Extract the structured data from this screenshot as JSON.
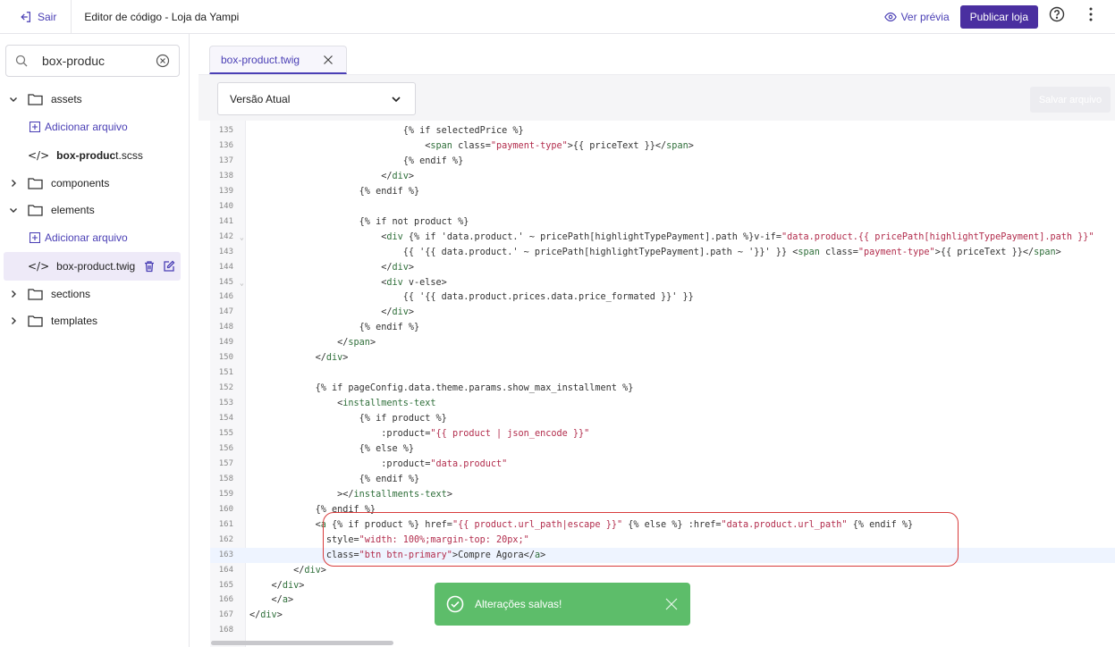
{
  "header": {
    "back_label": "Sair",
    "title": "Editor de código - Loja da Yampi",
    "preview_label": "Ver prévia",
    "publish_label": "Publicar loja"
  },
  "sidebar": {
    "search_value": "box-produc",
    "tree": {
      "assets": "assets",
      "add_file_1": "Adicionar arquivo",
      "scss_bold": "box-produc",
      "scss_rest": "t.scss",
      "components": "components",
      "elements": "elements",
      "add_file_2": "Adicionar arquivo",
      "twig_file": "box-product.twig",
      "sections": "sections",
      "templates": "templates"
    }
  },
  "editor": {
    "tab_label": "box-product.twig",
    "version_label": "Versão Atual",
    "save_label": "Salvar arquivo",
    "lines": [
      {
        "n": "135",
        "t": "                            {% if selectedPrice %}"
      },
      {
        "n": "136",
        "t": "                                <span class=\"payment-type\">{{ priceText }}</span>"
      },
      {
        "n": "137",
        "t": "                            {% endif %}"
      },
      {
        "n": "138",
        "t": "                        </div>"
      },
      {
        "n": "139",
        "t": "                    {% endif %}"
      },
      {
        "n": "140",
        "t": ""
      },
      {
        "n": "141",
        "t": "                    {% if not product %}"
      },
      {
        "n": "142",
        "t": "                        <div {% if 'data.product.' ~ pricePath[highlightTypePayment].path %}v-if=\"data.product.{{ pricePath[highlightTypePayment].path }}\""
      },
      {
        "n": "143",
        "t": "                            {{ '{{ data.product.' ~ pricePath[highlightTypePayment].path ~ '}}' }} <span class=\"payment-type\">{{ priceText }}</span>"
      },
      {
        "n": "144",
        "t": "                        </div>"
      },
      {
        "n": "145",
        "t": "                        <div v-else>"
      },
      {
        "n": "146",
        "t": "                            {{ '{{ data.product.prices.data.price_formated }}' }}"
      },
      {
        "n": "147",
        "t": "                        </div>"
      },
      {
        "n": "148",
        "t": "                    {% endif %}"
      },
      {
        "n": "149",
        "t": "                </span>"
      },
      {
        "n": "150",
        "t": "            </div>"
      },
      {
        "n": "151",
        "t": ""
      },
      {
        "n": "152",
        "t": "            {% if pageConfig.data.theme.params.show_max_installment %}"
      },
      {
        "n": "153",
        "t": "                <installments-text"
      },
      {
        "n": "154",
        "t": "                    {% if product %}"
      },
      {
        "n": "155",
        "t": "                        :product=\"{{ product | json_encode }}\""
      },
      {
        "n": "156",
        "t": "                    {% else %}"
      },
      {
        "n": "157",
        "t": "                        :product=\"data.product\""
      },
      {
        "n": "158",
        "t": "                    {% endif %}"
      },
      {
        "n": "159",
        "t": "                ></installments-text>"
      },
      {
        "n": "160",
        "t": "            {% endif %}"
      },
      {
        "n": "161",
        "t": "            <a {% if product %} href=\"{{ product.url_path|escape }}\" {% else %} :href=\"data.product.url_path\" {% endif %}"
      },
      {
        "n": "162",
        "t": "              style=\"width: 100%;margin-top: 20px;\""
      },
      {
        "n": "163",
        "t": "              class=\"btn btn-primary\">Compre Agora</a>"
      },
      {
        "n": "164",
        "t": "        </div>"
      },
      {
        "n": "165",
        "t": "    </div>"
      },
      {
        "n": "166",
        "t": "    </a>"
      },
      {
        "n": "167",
        "t": "</div>"
      },
      {
        "n": "168",
        "t": ""
      }
    ]
  },
  "toast": {
    "message": "Alterações salvas!"
  },
  "colors": {
    "accent": "#4a3fb5",
    "publish": "#4a2fa0",
    "toast": "#5dbd6a",
    "annotation": "#d83c3c"
  }
}
